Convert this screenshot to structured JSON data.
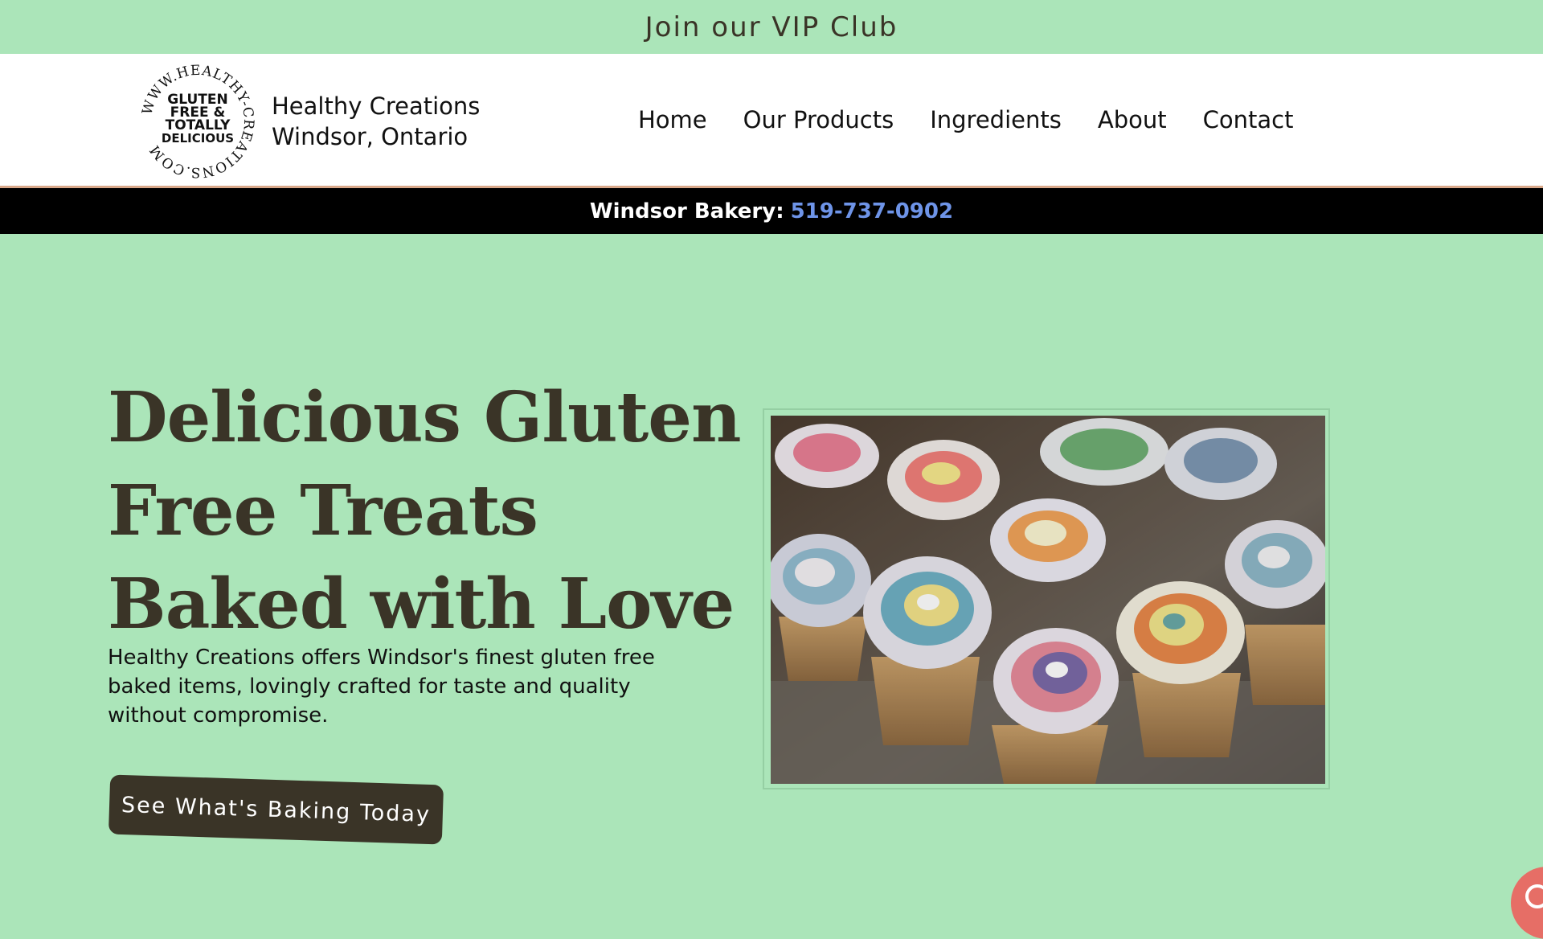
{
  "promo": {
    "label": "Join our VIP Club"
  },
  "brand": {
    "name": "Healthy Creations",
    "location": "Windsor, Ontario",
    "logo_ring_text": "WWW.HEALTHY-CREATIONS.COM",
    "logo_center_lines": [
      "GLUTEN",
      "FREE &",
      "TOTALLY",
      "DELICIOUS"
    ]
  },
  "nav": {
    "items": [
      {
        "label": "Home"
      },
      {
        "label": "Our Products"
      },
      {
        "label": "Ingredients"
      },
      {
        "label": "About"
      },
      {
        "label": "Contact"
      }
    ]
  },
  "phone_bar": {
    "label": "Windsor Bakery:",
    "number": "519-737-0902"
  },
  "hero": {
    "title_lines": [
      "Delicious Gluten",
      "Free Treats",
      "Baked with Love"
    ],
    "description": "Healthy Creations offers Windsor's finest gluten free baked items, lovingly crafted for taste and quality without compromise.",
    "cta_label": "See What's Baking Today"
  },
  "colors": {
    "page_background": "#ABE5B9",
    "heading": "#3A3427",
    "button": "#3A3427",
    "phone_link": "#6E94E8",
    "header_border": "#D9A88A",
    "chat_bubble": "#E66E66"
  },
  "icons": {
    "logo": "healthy-creations-round-logo",
    "chat": "chat-bubble-icon"
  }
}
